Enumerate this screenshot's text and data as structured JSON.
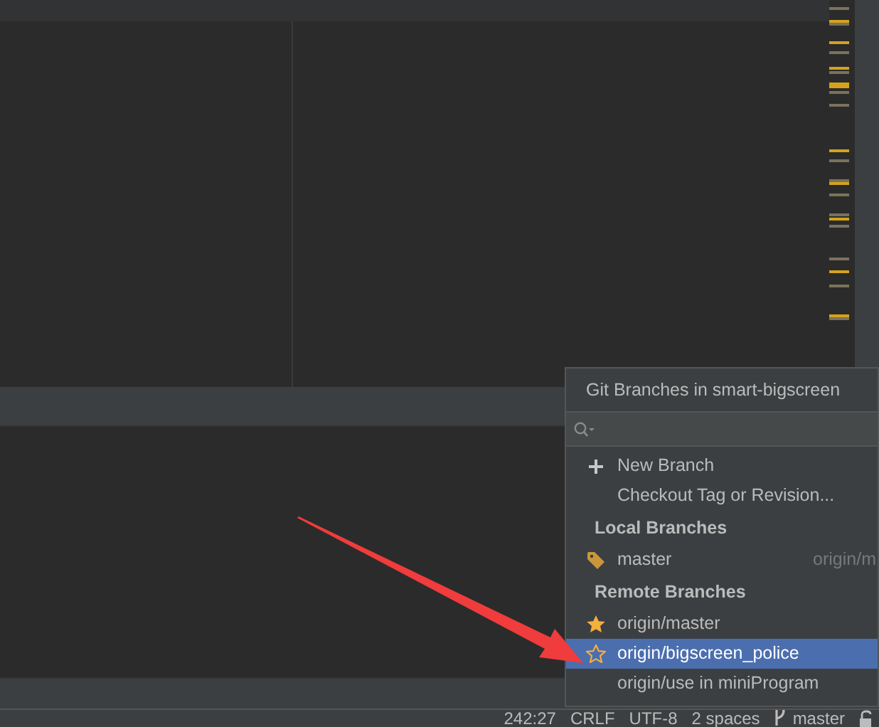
{
  "popup": {
    "title": "Git Branches in smart-bigscreen",
    "items": [
      {
        "kind": "new_branch",
        "label": "New Branch"
      },
      {
        "kind": "checkout",
        "label": "Checkout Tag or Revision..."
      },
      {
        "kind": "header",
        "label": "Local Branches"
      },
      {
        "kind": "local_branch",
        "label": "master",
        "tracking": "origin/m",
        "selected": false
      },
      {
        "kind": "header",
        "label": "Remote Branches"
      },
      {
        "kind": "remote_branch",
        "favorite": true,
        "label": "origin/master",
        "selected": false
      },
      {
        "kind": "remote_branch",
        "favorite": false,
        "label": "origin/bigscreen_police",
        "selected": true
      },
      {
        "kind": "remote_branch",
        "favorite": false,
        "label": "origin/use in miniProgram",
        "selected": false
      }
    ]
  },
  "status_bar": {
    "position": "242:27",
    "line_separator": "CRLF",
    "encoding": "UTF-8",
    "indent": "2 spaces",
    "branch": "master"
  }
}
